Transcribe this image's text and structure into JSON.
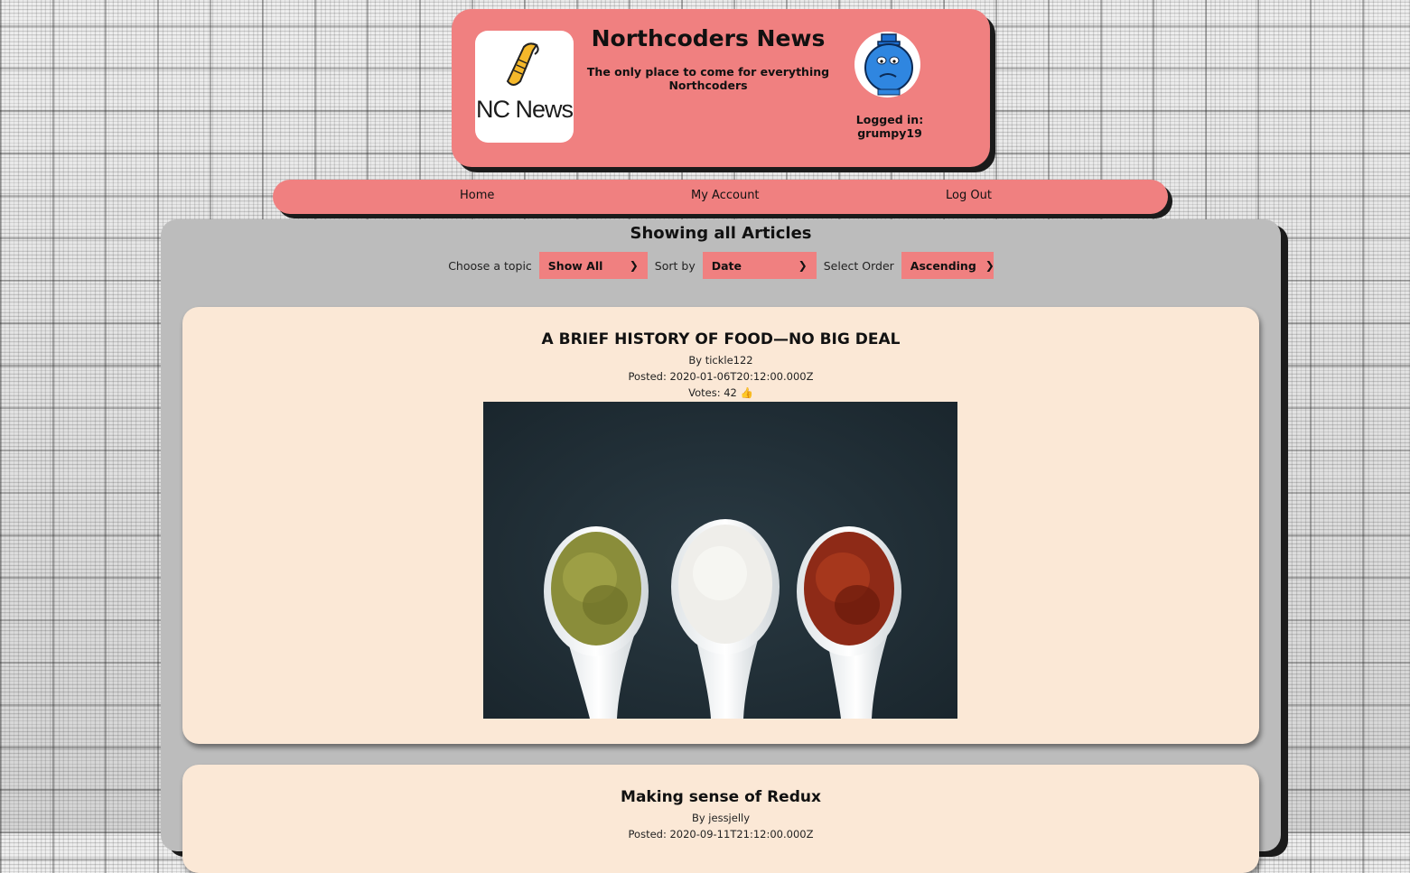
{
  "header": {
    "logo_text": "NC News",
    "title": "Northcoders News",
    "subtitle": "The only place to come for everything Northcoders",
    "logged_in": "Logged in: grumpy19"
  },
  "nav": {
    "items": [
      {
        "label": "Home"
      },
      {
        "label": "My Account"
      },
      {
        "label": "Log Out"
      }
    ]
  },
  "main": {
    "heading": "Showing all Articles",
    "filters": {
      "topic_label": "Choose a topic",
      "topic_value": "Show All",
      "sort_label": "Sort by",
      "sort_value": "Date",
      "order_label": "Select Order",
      "order_value": "Ascending"
    }
  },
  "articles": [
    {
      "title": "A BRIEF HISTORY OF FOOD—NO BIG DEAL",
      "author": "By tickle122",
      "posted": "Posted: 2020-01-06T20:12:00.000Z",
      "votes": "Votes: 42 👍"
    },
    {
      "title": "Making sense of Redux",
      "author": "By jessjelly",
      "posted": "Posted: 2020-09-11T21:12:00.000Z"
    }
  ],
  "colors": {
    "accent": "#f08080",
    "card": "#fbe8d6",
    "panel": "#bcbcbc"
  }
}
